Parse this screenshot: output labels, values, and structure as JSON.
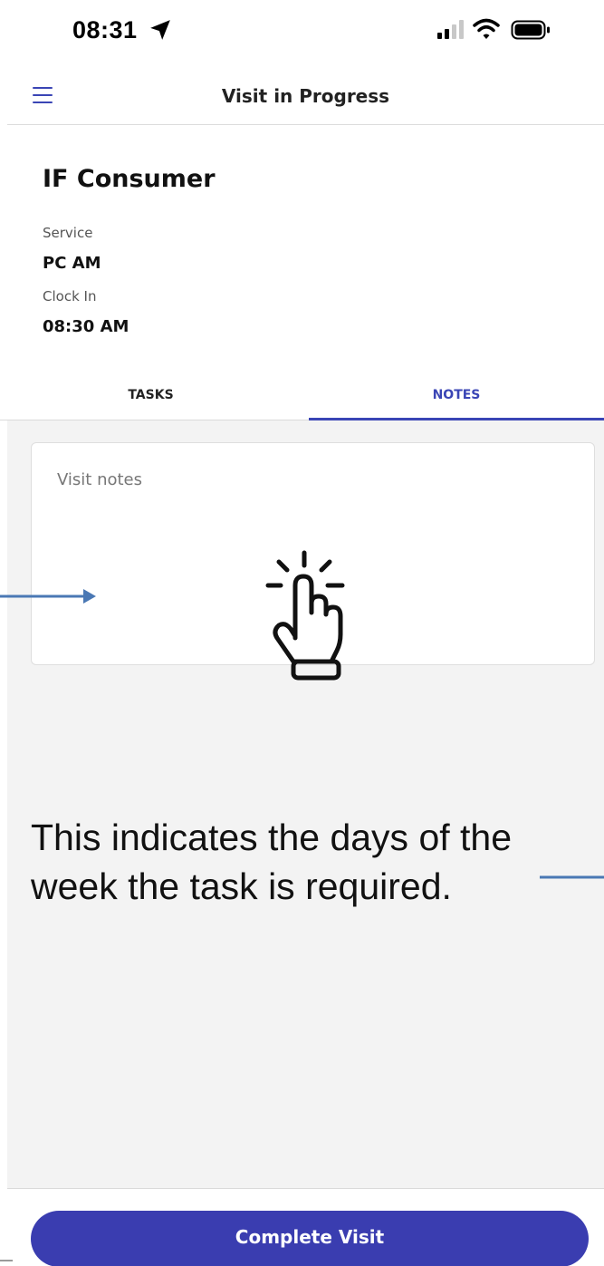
{
  "status_bar": {
    "time": "08:31",
    "icons": [
      "location-arrow-icon",
      "cellular-signal-icon",
      "wifi-icon",
      "battery-icon"
    ]
  },
  "header": {
    "title": "Visit in Progress",
    "menu_icon": "hamburger-menu-icon"
  },
  "visit": {
    "consumer_name": "IF Consumer",
    "service_label": "Service",
    "service_value": "PC AM",
    "clock_in_label": "Clock In",
    "clock_in_value": "08:30 AM"
  },
  "tabs": [
    {
      "label": "TASKS",
      "active": false
    },
    {
      "label": "NOTES",
      "active": true
    }
  ],
  "notes": {
    "placeholder": "Visit notes"
  },
  "annotation": {
    "text": "This indicates the days of the week the task is required.",
    "icons": [
      "tap-hand-icon",
      "arrow-right-icon",
      "line-pointer-icon"
    ]
  },
  "footer": {
    "complete_label": "Complete Visit"
  },
  "colors": {
    "accent": "#3a45b5",
    "button": "#3a3db0",
    "content_bg": "#f3f3f3",
    "arrow": "#4a78b4"
  }
}
